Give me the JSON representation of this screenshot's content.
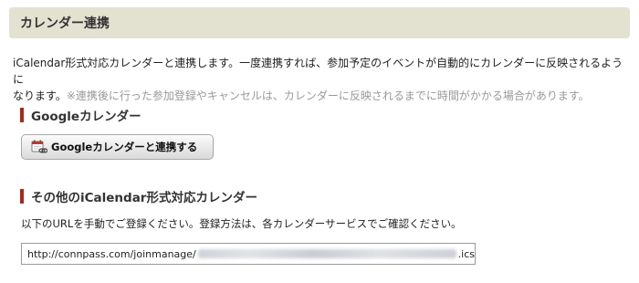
{
  "header": {
    "title": "カレンダー連携"
  },
  "description": {
    "line1": "iCalendar形式対応カレンダーと連携します。一度連携すれば、参加予定のイベントが自動的にカレンダーに反映されるように",
    "line2": "なります。",
    "note": "※連携後に行った参加登録やキャンセルは、カレンダーに反映されるまでに時間がかかる場合があります。"
  },
  "google_section": {
    "heading": "Googleカレンダー",
    "button_label": "Googleカレンダーと連携する",
    "button_icon": "calendar-link-icon"
  },
  "ical_section": {
    "heading": "その他のiCalendar形式対応カレンダー",
    "instructions": "以下のURLを手動でご登録ください。登録方法は、各カレンダーサービスでご確認ください。",
    "url_prefix": "http://connpass.com/joinmanage/",
    "url_suffix": ".ics"
  },
  "colors": {
    "header_bg": "#e3e1d0",
    "accent_bar": "#a52a1c",
    "note_text": "#999999"
  }
}
